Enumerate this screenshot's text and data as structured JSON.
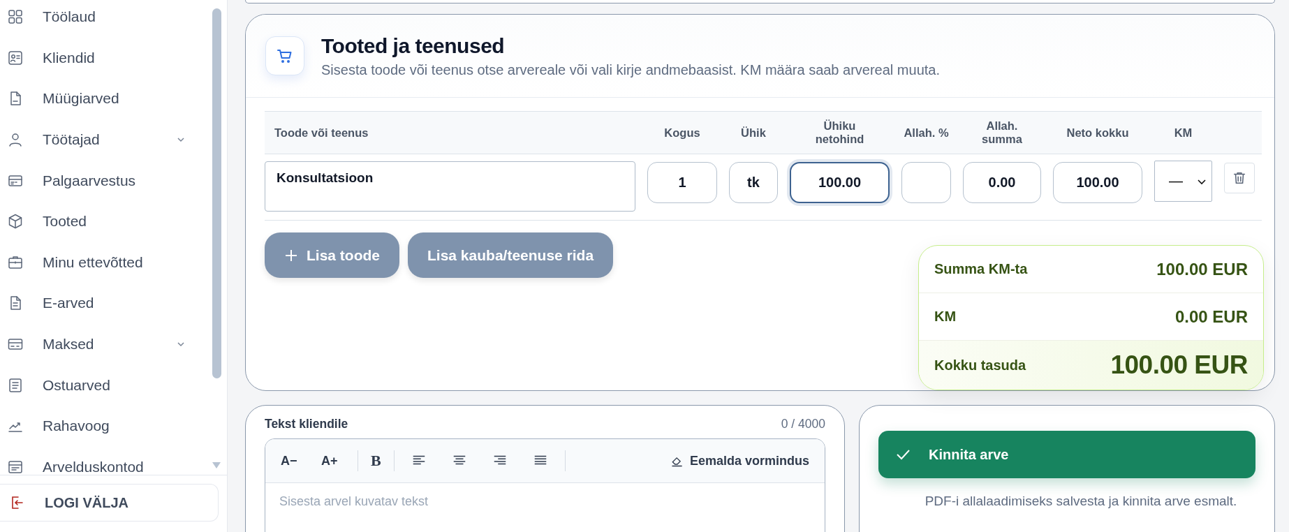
{
  "sidebar": {
    "items": [
      {
        "label": "Töölaud",
        "expandable": false
      },
      {
        "label": "Kliendid",
        "expandable": false
      },
      {
        "label": "Müügiarved",
        "expandable": false
      },
      {
        "label": "Töötajad",
        "expandable": true
      },
      {
        "label": "Palgaarvestus",
        "expandable": false
      },
      {
        "label": "Tooted",
        "expandable": false
      },
      {
        "label": "Minu ettevõtted",
        "expandable": false
      },
      {
        "label": "E-arved",
        "expandable": false
      },
      {
        "label": "Maksed",
        "expandable": true
      },
      {
        "label": "Ostuarved",
        "expandable": false
      },
      {
        "label": "Rahavoog",
        "expandable": false
      },
      {
        "label": "Arvelduskontod",
        "expandable": false
      }
    ],
    "logout": "LOGI VÄLJA"
  },
  "products": {
    "title": "Tooted ja teenused",
    "subtitle": "Sisesta toode või teenus otse arvereale või vali kirje andmebaasist. KM määra saab arvereal muuta.",
    "columns": [
      "Toode või teenus",
      "Kogus",
      "Ühik",
      "Ühiku netohind",
      "Allah. %",
      "Allah. summa",
      "Neto kokku",
      "KM"
    ],
    "rows": [
      {
        "cells": [
          {
            "kind": "name",
            "value": "Konsultatsioon",
            "focused": false
          },
          {
            "kind": "number",
            "value": "1",
            "focused": false
          },
          {
            "kind": "number",
            "value": "tk",
            "focused": false
          },
          {
            "kind": "number",
            "value": "100.00",
            "focused": true
          },
          {
            "kind": "number",
            "focused": false
          },
          {
            "kind": "number",
            "value": "0.00",
            "focused": false
          },
          {
            "kind": "number",
            "value": "100.00",
            "focused": false
          },
          {
            "kind": "select",
            "value": "—",
            "focused": false
          }
        ]
      }
    ],
    "buttons": [
      {
        "label": "Lisa toode",
        "kind": "add"
      },
      {
        "label": "Lisa kauba/teenuse rida",
        "kind": "plain"
      }
    ],
    "totals": [
      {
        "label": "Summa KM-ta",
        "value": "100.00 EUR",
        "kind": "row"
      },
      {
        "label": "KM",
        "value": "0.00 EUR",
        "kind": "row"
      },
      {
        "label": "Kokku tasuda",
        "value": "100.00 EUR",
        "kind": "grand"
      }
    ]
  },
  "customer_text": {
    "label": "Tekst kliendile",
    "counter": "0 / 4000",
    "toolbar": [
      {
        "kind": "text",
        "label": "A−"
      },
      {
        "kind": "text",
        "label": "A+"
      },
      {
        "kind": "separator"
      },
      {
        "kind": "bold",
        "label": "B"
      },
      {
        "kind": "separator"
      },
      {
        "kind": "align-left"
      },
      {
        "kind": "align-center"
      },
      {
        "kind": "align-right"
      },
      {
        "kind": "align-justify"
      },
      {
        "kind": "separator"
      },
      {
        "kind": "clear",
        "label": "Eemalda vormindus"
      }
    ],
    "placeholder": "Sisesta arvel kuvatav tekst"
  },
  "confirm": {
    "button": "Kinnita arve",
    "note": "PDF-i allalaadimiseks salvesta ja kinnita arve esmalt."
  }
}
